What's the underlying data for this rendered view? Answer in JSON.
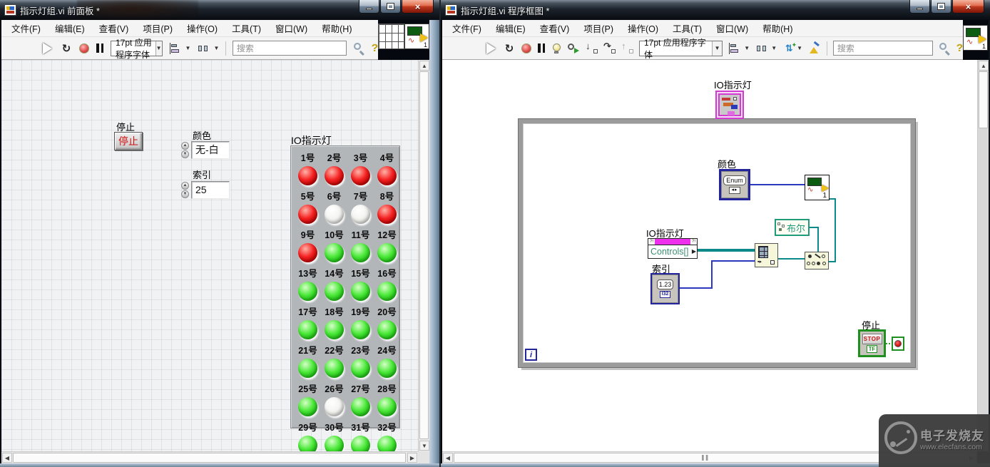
{
  "menu_items": [
    "文件(F)",
    "编辑(E)",
    "查看(V)",
    "项目(P)",
    "操作(O)",
    "工具(T)",
    "窗口(W)",
    "帮助(H)"
  ],
  "left": {
    "title": "指示灯组.vi 前面板 *",
    "font_selector": "17pt 应用程序字体",
    "search_placeholder": "搜索",
    "panel": {
      "stop": {
        "label": "停止",
        "button": "停止"
      },
      "color": {
        "label": "颜色",
        "value": "无-白"
      },
      "index": {
        "label": "索引",
        "value": "25"
      },
      "leds": {
        "label": "IO指示灯",
        "items": [
          {
            "n": "1号",
            "c": "red"
          },
          {
            "n": "2号",
            "c": "red"
          },
          {
            "n": "3号",
            "c": "red"
          },
          {
            "n": "4号",
            "c": "red"
          },
          {
            "n": "5号",
            "c": "red"
          },
          {
            "n": "6号",
            "c": "white"
          },
          {
            "n": "7号",
            "c": "white"
          },
          {
            "n": "8号",
            "c": "red"
          },
          {
            "n": "9号",
            "c": "red"
          },
          {
            "n": "10号",
            "c": "green"
          },
          {
            "n": "11号",
            "c": "green"
          },
          {
            "n": "12号",
            "c": "green"
          },
          {
            "n": "13号",
            "c": "green"
          },
          {
            "n": "14号",
            "c": "green"
          },
          {
            "n": "15号",
            "c": "green"
          },
          {
            "n": "16号",
            "c": "green"
          },
          {
            "n": "17号",
            "c": "green"
          },
          {
            "n": "18号",
            "c": "green"
          },
          {
            "n": "19号",
            "c": "green"
          },
          {
            "n": "20号",
            "c": "green"
          },
          {
            "n": "21号",
            "c": "green"
          },
          {
            "n": "22号",
            "c": "green"
          },
          {
            "n": "23号",
            "c": "green"
          },
          {
            "n": "24号",
            "c": "green"
          },
          {
            "n": "25号",
            "c": "green"
          },
          {
            "n": "26号",
            "c": "white"
          },
          {
            "n": "27号",
            "c": "green"
          },
          {
            "n": "28号",
            "c": "green"
          },
          {
            "n": "29号",
            "c": "green"
          },
          {
            "n": "30号",
            "c": "green"
          },
          {
            "n": "31号",
            "c": "green"
          },
          {
            "n": "32号",
            "c": "green"
          }
        ]
      }
    }
  },
  "right": {
    "title": "指示灯组.vi 程序框图 *",
    "font_selector": "17pt 应用程序字体",
    "search_placeholder": "搜索",
    "diagram": {
      "cluster_label": "IO指示灯",
      "enum": {
        "label": "颜色",
        "text": "Enum",
        "arrows": "◂▸"
      },
      "subvi_number": "1",
      "prop_node": {
        "label": "IO指示灯",
        "text": "Controls[]"
      },
      "index": {
        "label": "索引",
        "text": "1.23",
        "dtype": "I32"
      },
      "bool_class": "布尔",
      "stop": {
        "label": "停止",
        "text": "STOP",
        "dtype": "TF"
      },
      "iterator": "i"
    }
  },
  "watermark": {
    "brand": "电子发烧友",
    "url": "www.elecfans.com"
  },
  "colors": {
    "wire_reference": "#0c8a8a",
    "wire_integer": "#2a39c0",
    "wire_boolean": "#2f9e2f",
    "led_red": "#f52222",
    "led_green": "#1ecb14",
    "led_off_white": "#f2f2ef",
    "terminal_blue": "#24249c",
    "terminal_green": "#1f8f1f",
    "terminal_magenta": "#d23ad2"
  }
}
